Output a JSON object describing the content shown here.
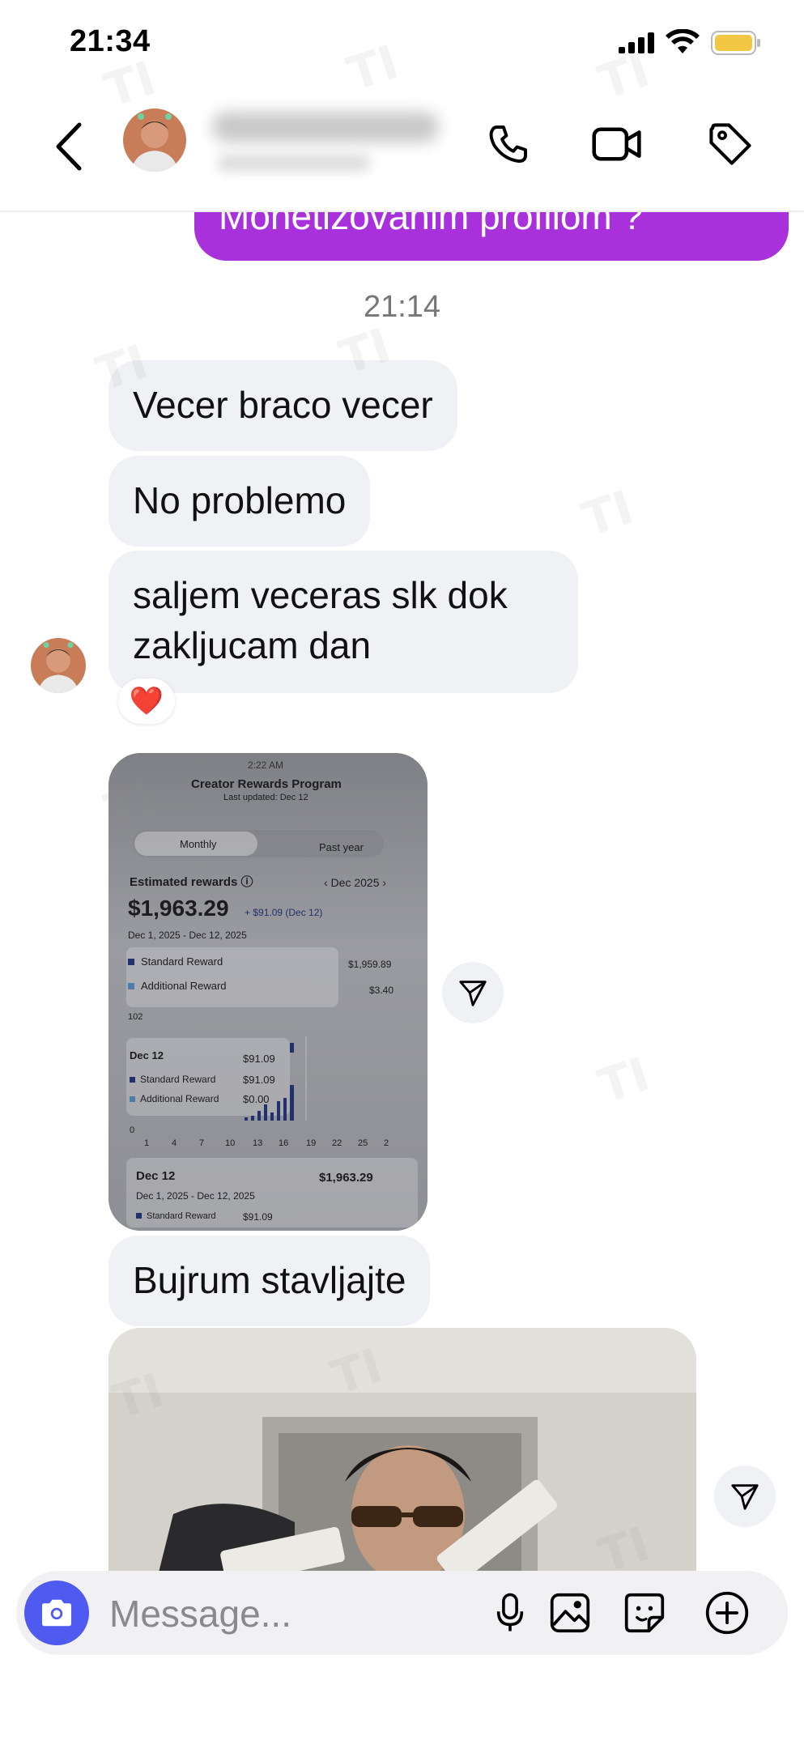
{
  "status_bar": {
    "time": "21:34"
  },
  "header": {
    "back_icon": "chevron-left-icon",
    "call_icon": "phone-icon",
    "video_icon": "video-camera-icon",
    "tag_icon": "tag-icon"
  },
  "messages": {
    "sent_partial": "Monetizovanim profilom ?",
    "timestamp": "21:14",
    "received": [
      "Vecer braco vecer",
      "No problemo",
      "saljem veceras slk dok zakljucam dan",
      "Bujrum stavljajte"
    ],
    "reaction": "❤️"
  },
  "screenshot_image": {
    "status_time": "2:22 AM",
    "title": "Creator Rewards Program",
    "updated": "Last updated: Dec 12",
    "tab_monthly": "Monthly",
    "tab_past_year": "Past year",
    "estimated_label": "Estimated rewards ⓘ",
    "month": "‹ Dec 2025 ›",
    "amount": "$1,963.29",
    "delta": "+ $91.09 (Dec 12)",
    "range": "Dec 1, 2025 - Dec 12, 2025",
    "standard_label": "Standard Reward",
    "standard_value": "$1,959.89",
    "additional_label": "Additional Reward",
    "additional_value": "$3.40",
    "axis_top": "102",
    "tooltip_date": "Dec 12",
    "tooltip_total": "$91.09",
    "tooltip_standard": "$91.09",
    "tooltip_additional": "$0.00",
    "axis_zero": "0",
    "x_ticks": [
      "1",
      "4",
      "7",
      "10",
      "13",
      "16",
      "19",
      "22",
      "25",
      "2"
    ],
    "footer_date": "Dec 12",
    "footer_amount": "$1,963.29",
    "footer_range": "Dec 1, 2025 - Dec 12, 2025",
    "footer_standard": "Standard Reward",
    "footer_standard_value": "$91.09"
  },
  "composer": {
    "placeholder": "Message...",
    "icons": [
      "camera-icon",
      "microphone-icon",
      "gallery-icon",
      "sticker-icon",
      "plus-icon"
    ]
  },
  "watermark": "TI"
}
